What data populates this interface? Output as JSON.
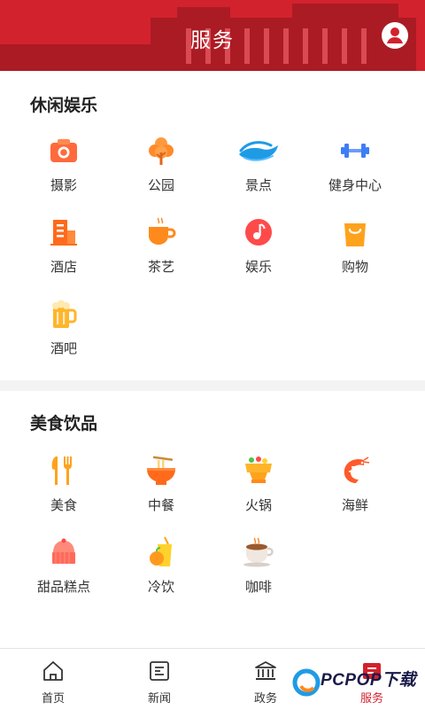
{
  "header": {
    "title": "服务"
  },
  "section_leisure": {
    "title": "休闲娱乐",
    "items": [
      {
        "label": "摄影",
        "icon": "camera-icon"
      },
      {
        "label": "公园",
        "icon": "tree-icon"
      },
      {
        "label": "景点",
        "icon": "wave-icon"
      },
      {
        "label": "健身中心",
        "icon": "dumbbell-icon"
      },
      {
        "label": "酒店",
        "icon": "hotel-icon"
      },
      {
        "label": "茶艺",
        "icon": "tea-cup-icon"
      },
      {
        "label": "娱乐",
        "icon": "music-note-icon"
      },
      {
        "label": "购物",
        "icon": "shopping-bag-icon"
      },
      {
        "label": "酒吧",
        "icon": "beer-mug-icon"
      }
    ]
  },
  "section_food": {
    "title": "美食饮品",
    "items": [
      {
        "label": "美食",
        "icon": "fork-knife-icon"
      },
      {
        "label": "中餐",
        "icon": "noodle-bowl-icon"
      },
      {
        "label": "火锅",
        "icon": "hotpot-icon"
      },
      {
        "label": "海鲜",
        "icon": "shrimp-icon"
      },
      {
        "label": "甜品糕点",
        "icon": "cake-icon"
      },
      {
        "label": "冷饮",
        "icon": "juice-icon"
      },
      {
        "label": "咖啡",
        "icon": "coffee-cup-icon"
      }
    ]
  },
  "tabbar": {
    "tabs": [
      {
        "label": "首页",
        "icon": "home-icon"
      },
      {
        "label": "新闻",
        "icon": "news-icon"
      },
      {
        "label": "政务",
        "icon": "government-icon"
      },
      {
        "label": "服务",
        "icon": "service-icon",
        "active": true
      }
    ]
  },
  "watermark": {
    "text": "PCPOP下载"
  },
  "colors": {
    "brand": "#d2222d",
    "orange": "#ff7a2a",
    "yellow": "#ffb52b",
    "blue": "#3d7ef5"
  }
}
